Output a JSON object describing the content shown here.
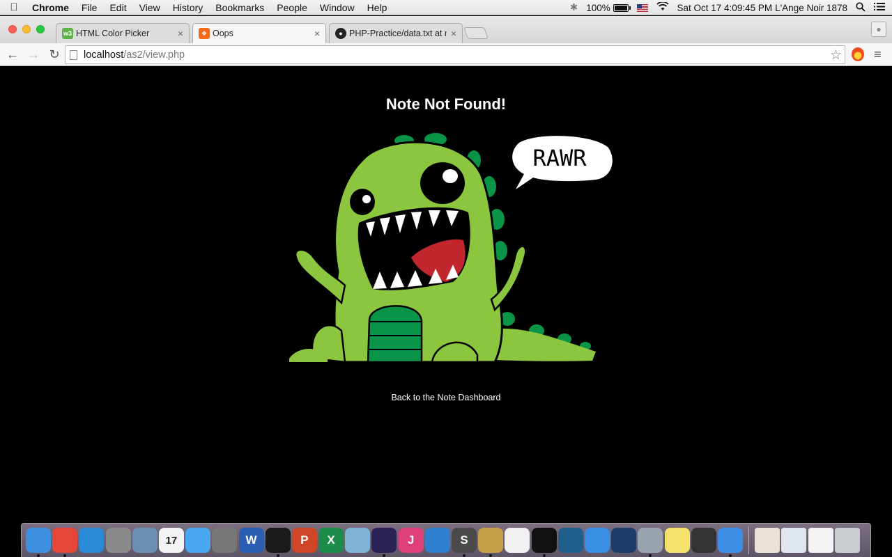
{
  "menubar": {
    "apple_icon": "apple-logo",
    "app_name": "Chrome",
    "items": [
      "File",
      "Edit",
      "View",
      "History",
      "Bookmarks",
      "People",
      "Window",
      "Help"
    ],
    "battery": "100%",
    "datetime": "Sat Oct 17  4:09:45 PM",
    "user": "L'Ange Noir 1878"
  },
  "tabs": [
    {
      "title": "HTML Color Picker",
      "favicon": "w3-icon",
      "favicon_color": "#5fb048",
      "active": false
    },
    {
      "title": "Oops",
      "favicon": "xampp-icon",
      "favicon_color": "#f26b1d",
      "active": true
    },
    {
      "title": "PHP-Practice/data.txt at m",
      "favicon": "github-icon",
      "favicon_color": "#222222",
      "active": false
    }
  ],
  "toolbar": {
    "url_host": "localhost",
    "url_path": "/as2/view.php"
  },
  "page": {
    "heading": "Note Not Found!",
    "speech_bubble": "RAWR",
    "back_link": "Back to the Note Dashboard",
    "dino_color": "#8cc63f",
    "spike_color": "#0a9447",
    "mouth_color": "#c1272d"
  },
  "dock": {
    "apps": [
      {
        "name": "finder",
        "color": "#3f8fe0",
        "label": ""
      },
      {
        "name": "chrome",
        "color": "#e6463a",
        "label": ""
      },
      {
        "name": "safari",
        "color": "#2a8ad8",
        "label": ""
      },
      {
        "name": "calculator",
        "color": "#8a8a8a",
        "label": ""
      },
      {
        "name": "preview",
        "color": "#6b8fb3",
        "label": ""
      },
      {
        "name": "calendar",
        "color": "#f2f2f2",
        "label": "17"
      },
      {
        "name": "messages",
        "color": "#4aa8f0",
        "label": ""
      },
      {
        "name": "system-preferences",
        "color": "#777777",
        "label": ""
      },
      {
        "name": "word",
        "color": "#2b5eb0",
        "label": "W"
      },
      {
        "name": "qq",
        "color": "#1a1a1a",
        "label": ""
      },
      {
        "name": "powerpoint",
        "color": "#d04525",
        "label": "P"
      },
      {
        "name": "excel",
        "color": "#1f8b4a",
        "label": "X"
      },
      {
        "name": "virtualbox",
        "color": "#7fb3d8",
        "label": ""
      },
      {
        "name": "eclipse",
        "color": "#2c2255",
        "label": ""
      },
      {
        "name": "intellij",
        "color": "#e0407a",
        "label": "J"
      },
      {
        "name": "weather",
        "color": "#2f7fd0",
        "label": ""
      },
      {
        "name": "sublime",
        "color": "#4a4a4a",
        "label": "S"
      },
      {
        "name": "archive",
        "color": "#c9a04a",
        "label": ""
      },
      {
        "name": "photos",
        "color": "#f0f0f0",
        "label": ""
      },
      {
        "name": "terminal",
        "color": "#111111",
        "label": ""
      },
      {
        "name": "mysql-workbench",
        "color": "#1f5f8a",
        "label": ""
      },
      {
        "name": "xcode",
        "color": "#3a8ee6",
        "label": ""
      },
      {
        "name": "quicktime",
        "color": "#1d3c6a",
        "label": ""
      },
      {
        "name": "settings",
        "color": "#9aa4ae",
        "label": ""
      },
      {
        "name": "stickies",
        "color": "#f4e06a",
        "label": ""
      },
      {
        "name": "printer",
        "color": "#333333",
        "label": ""
      },
      {
        "name": "icloud",
        "color": "#3d8fe8",
        "label": ""
      }
    ],
    "right": [
      {
        "name": "documents-stack",
        "color": "#e8e3d6"
      },
      {
        "name": "downloads-stack",
        "color": "#dfe6ee"
      },
      {
        "name": "screenshots-stack",
        "color": "#f3f3f3"
      },
      {
        "name": "trash",
        "color": "#c9cdd1"
      }
    ]
  }
}
